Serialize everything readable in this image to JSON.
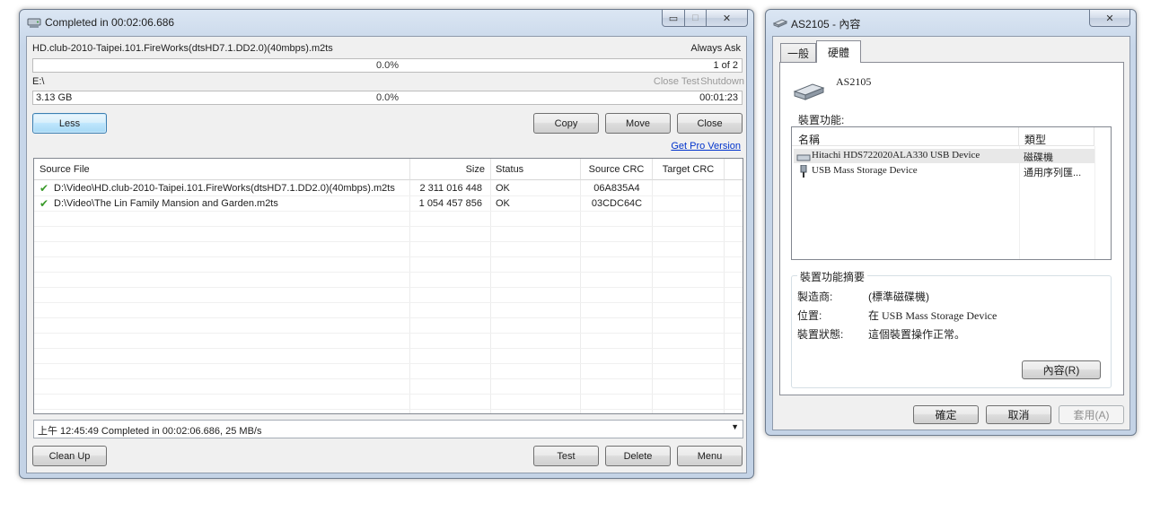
{
  "copy_window": {
    "title": "Completed in 00:02:06.686",
    "source_path": "HD.club-2010-Taipei.101.FireWorks(dtsHD7.1.DD2.0)(40mbps).m2ts",
    "always_ask": "Always Ask",
    "progress1_pct": "0.0%",
    "file_count": "1 of 2",
    "target_path": "E:\\",
    "post_actions": [
      "Close",
      "Test",
      "Shutdown"
    ],
    "total_size": "3.13 GB",
    "progress2_pct": "0.0%",
    "remaining_time": "00:01:23",
    "less_label": "Less",
    "copy_label": "Copy",
    "move_label": "Move",
    "close_label": "Close",
    "pro_link": "Get Pro Version",
    "table": {
      "headers": [
        "Source File",
        "Size",
        "Status",
        "Source CRC",
        "Target CRC"
      ],
      "rows": [
        {
          "file": "D:\\Video\\HD.club-2010-Taipei.101.FireWorks(dtsHD7.1.DD2.0)(40mbps).m2ts",
          "size": "2 311 016 448",
          "status": "OK",
          "source_crc": "06A835A4",
          "target_crc": ""
        },
        {
          "file": "D:\\Video\\The Lin Family Mansion and Garden.m2ts",
          "size": "1 054 457 856",
          "status": "OK",
          "source_crc": "03CDC64C",
          "target_crc": ""
        }
      ]
    },
    "log_line": "上午 12:45:49 Completed in 00:02:06.686, 25 MB/s",
    "cleanup_label": "Clean Up",
    "test_label": "Test",
    "delete_label": "Delete",
    "menu_label": "Menu"
  },
  "props_window": {
    "title": "AS2105 - 內容",
    "tabs": [
      "一般",
      "硬體"
    ],
    "device_name": "AS2105",
    "functions_label": "裝置功能:",
    "list_headers": [
      "名稱",
      "類型"
    ],
    "devices": [
      {
        "name": "Hitachi HDS722020ALA330 USB Device",
        "type": "磁碟機"
      },
      {
        "name": "USB Mass Storage Device",
        "type": "通用序列匯..."
      }
    ],
    "summary_label": "裝置功能摘要",
    "manufacturer_label": "製造商:",
    "manufacturer_value": "(標準磁碟機)",
    "location_label": "位置:",
    "location_value": "在 USB Mass Storage Device",
    "status_label": "裝置狀態:",
    "status_value": "這個裝置操作正常。",
    "properties_btn": "內容(R)",
    "ok_btn": "確定",
    "cancel_btn": "取消",
    "apply_btn": "套用(A)"
  }
}
